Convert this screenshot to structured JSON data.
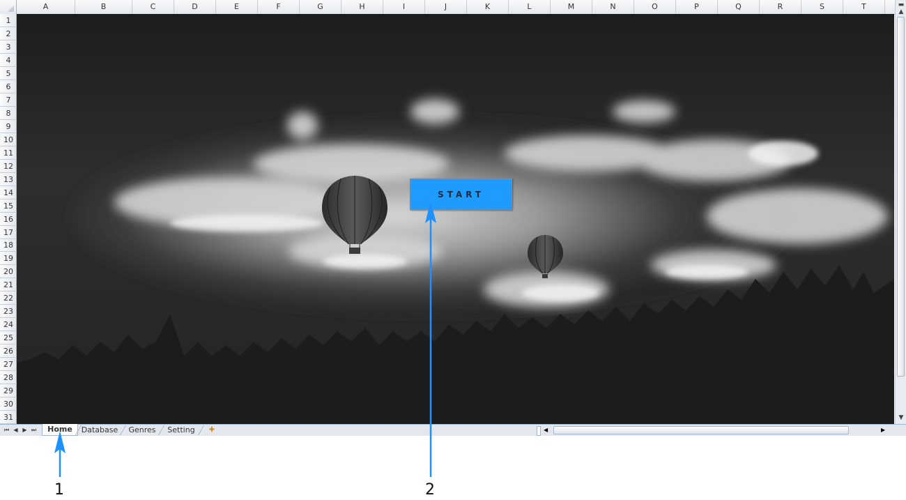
{
  "columns": [
    "A",
    "B",
    "C",
    "D",
    "E",
    "F",
    "G",
    "H",
    "I",
    "J",
    "K",
    "L",
    "M",
    "N",
    "O",
    "P",
    "Q",
    "R",
    "S",
    "T"
  ],
  "rows": [
    "1",
    "2",
    "3",
    "4",
    "5",
    "6",
    "7",
    "8",
    "9",
    "10",
    "11",
    "12",
    "13",
    "14",
    "15",
    "16",
    "17",
    "18",
    "19",
    "20",
    "21",
    "22",
    "23",
    "24",
    "25",
    "26",
    "27",
    "28",
    "29",
    "30",
    "31"
  ],
  "start_button": {
    "label": "START"
  },
  "sheet_tabs": [
    "Home",
    "Database",
    "Genres",
    "Setting"
  ],
  "active_tab": "Home",
  "callouts": [
    "1",
    "2"
  ],
  "colors": {
    "button": "#1e9bff",
    "arrow": "#1e90ff",
    "sky": "#2a2a2a"
  }
}
